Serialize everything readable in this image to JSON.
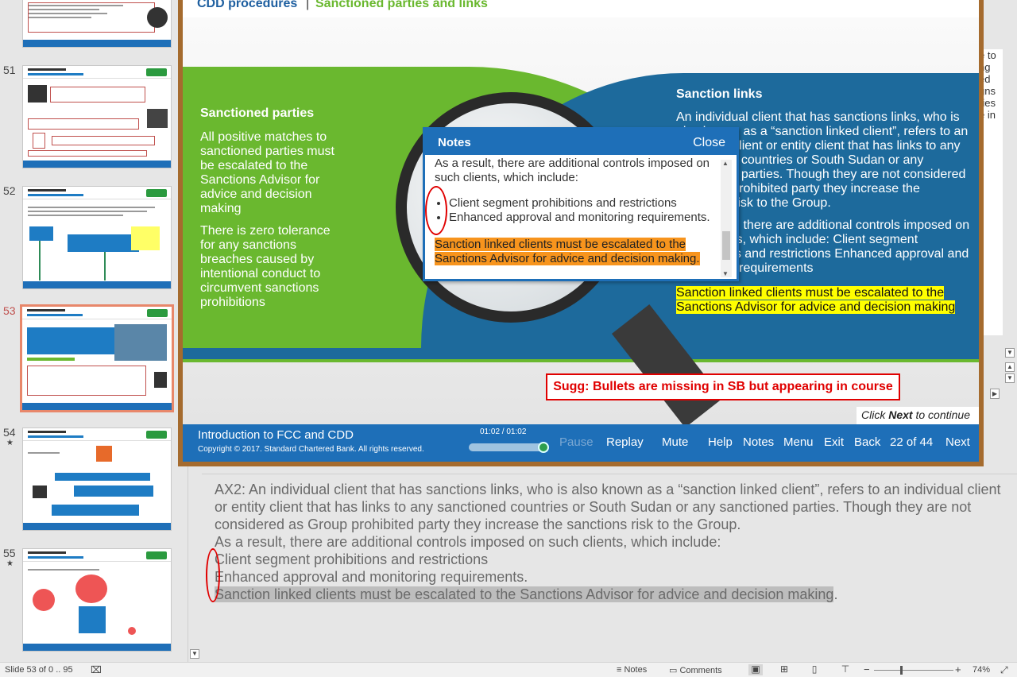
{
  "thumbnails": [
    {
      "num": "",
      "star": false
    },
    {
      "num": "51",
      "star": false
    },
    {
      "num": "52",
      "star": false
    },
    {
      "num": "53",
      "star": false,
      "active": true
    },
    {
      "num": "54",
      "star": true
    },
    {
      "num": "55",
      "star": true
    }
  ],
  "star_glyph": "★",
  "right_text_lines": [
    "e to",
    "ng",
    "ed",
    "gns",
    "ries",
    "e in"
  ],
  "slide": {
    "header_left": "CDD procedures",
    "header_sep": "|",
    "header_right": "Sanctioned parties and links",
    "sanctioned_parties": {
      "title": "Sanctioned parties",
      "para1": "All positive matches to sanctioned parties must be escalated to the Sanctions Advisor for advice and decision making",
      "para2": "There is zero tolerance for any sanctions breaches caused by intentional conduct to circumvent sanctions prohibitions"
    },
    "sanction_links": {
      "title": "Sanction links",
      "para1": "An individual client that has sanctions links, who is also known as a “sanction linked client”, refers to an individual client or entity client that has links to any sanctioned countries or South Sudan or any sanctioned parties. Though they are not considered as Group prohibited party they increase the sanctions risk to the Group.",
      "para2": "As a result, there are additional controls imposed on such clients, which include: Client segment prohibitions and restrictions Enhanced approval and monitoring requirements",
      "highlight": "Sanction linked clients must be escalated to the Sanctions Advisor for advice and decision making"
    },
    "suggestion": "Sugg: Bullets are missing in SB but appearing in course",
    "click_next": {
      "pre": "Click ",
      "bold": "Next",
      "post": " to continue"
    },
    "notes_popup": {
      "title": "Notes",
      "close": "Close",
      "line1": "As a result, there are additional controls imposed on such clients, which include:",
      "bullets": [
        "Client segment prohibitions and restrictions",
        "Enhanced approval and monitoring requirements."
      ],
      "highlight": "Sanction linked clients must be escalated to the Sanctions Advisor for advice and decision making",
      "highlight_tail": "."
    },
    "player": {
      "course_name": "Introduction to FCC and CDD",
      "copyright": "Copyright © 2017. Standard Chartered Bank. All rights reserved.",
      "time": "01:02 / 01:02",
      "progress": 1.0,
      "buttons": {
        "pause": "Pause",
        "replay": "Replay",
        "mute": "Mute",
        "help": "Help",
        "notes": "Notes",
        "menu": "Menu",
        "exit": "Exit",
        "back": "Back",
        "page": "22 of 44",
        "next": "Next"
      }
    }
  },
  "speaker_notes": {
    "line1": "AX2: An individual client that has sanctions links, who is also known as a “sanction linked client”, refers to an individual client or entity client that has links to any sanctioned countries or South Sudan or any sanctioned parties. Though they are not considered as Group prohibited party they increase the sanctions risk to the Group.",
    "line2": "As a result, there are additional controls imposed on such clients, which include:",
    "line3": "Client segment prohibitions and restrictions",
    "line4": "Enhanced approval and monitoring requirements.",
    "line5": "Sanction linked clients must be escalated to the Sanctions Advisor for advice and decision making",
    "line5_tail": "."
  },
  "statusbar": {
    "slide_info": "Slide 53 of 0 .. 95",
    "notes": "Notes",
    "comments": "Comments",
    "zoom": "74%"
  }
}
